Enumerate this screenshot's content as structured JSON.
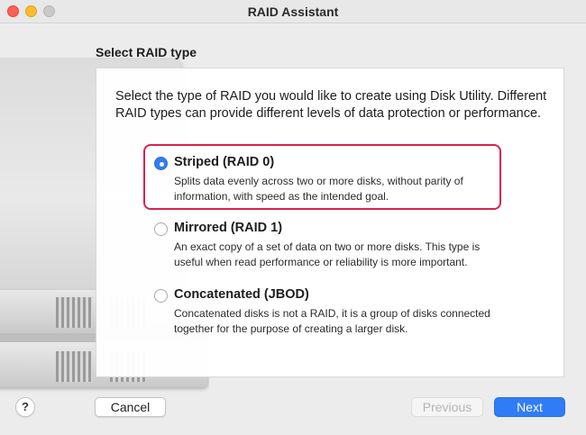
{
  "window": {
    "title": "RAID Assistant"
  },
  "section_title": "Select RAID type",
  "intro_text": "Select the type of RAID you would like to create using Disk Utility. Different RAID types can provide different levels of data protection or performance.",
  "options": [
    {
      "title": "Striped (RAID 0)",
      "description": "Splits data evenly across two or more disks, without parity of information, with speed as the intended goal.",
      "selected": true
    },
    {
      "title": "Mirrored (RAID 1)",
      "description": "An exact copy of a set of data on two or more disks. This type is useful when read performance or reliability is more important.",
      "selected": false
    },
    {
      "title": "Concatenated (JBOD)",
      "description": "Concatenated disks is not a RAID, it is a group of disks connected together for the purpose of creating a larger disk.",
      "selected": false
    }
  ],
  "footer": {
    "help_label": "?",
    "cancel_label": "Cancel",
    "previous_label": "Previous",
    "next_label": "Next"
  },
  "colors": {
    "accent": "#2f7cf6",
    "highlight": "#d9224f"
  },
  "icons": {
    "drive_art": "raid-drives-illustration"
  }
}
